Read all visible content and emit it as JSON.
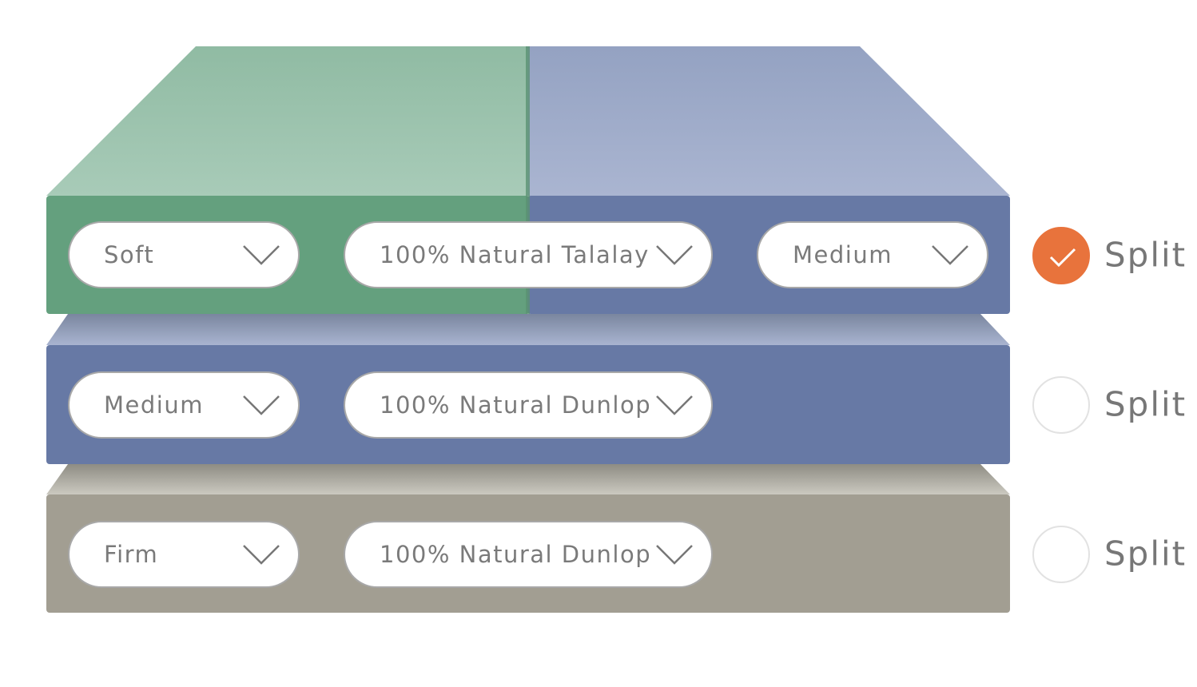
{
  "colors": {
    "soft_green": "#64a07e",
    "medium_blue": "#6779a5",
    "firm_gray": "#a29e92",
    "accent_orange": "#e8733c"
  },
  "layers": [
    {
      "selects": [
        {
          "value": "Soft",
          "icon": "chevron-down-icon"
        },
        {
          "value": "100% Natural Talalay",
          "icon": "chevron-down-icon"
        },
        {
          "value": "Medium",
          "icon": "chevron-down-icon"
        }
      ],
      "split": {
        "label": "Split",
        "checked": true
      }
    },
    {
      "selects": [
        {
          "value": "Medium",
          "icon": "chevron-down-icon"
        },
        {
          "value": "100% Natural Dunlop",
          "icon": "chevron-down-icon"
        }
      ],
      "split": {
        "label": "Split",
        "checked": false
      }
    },
    {
      "selects": [
        {
          "value": "Firm",
          "icon": "chevron-down-icon"
        },
        {
          "value": "100% Natural Dunlop",
          "icon": "chevron-down-icon"
        }
      ],
      "split": {
        "label": "Split",
        "checked": false
      }
    }
  ]
}
